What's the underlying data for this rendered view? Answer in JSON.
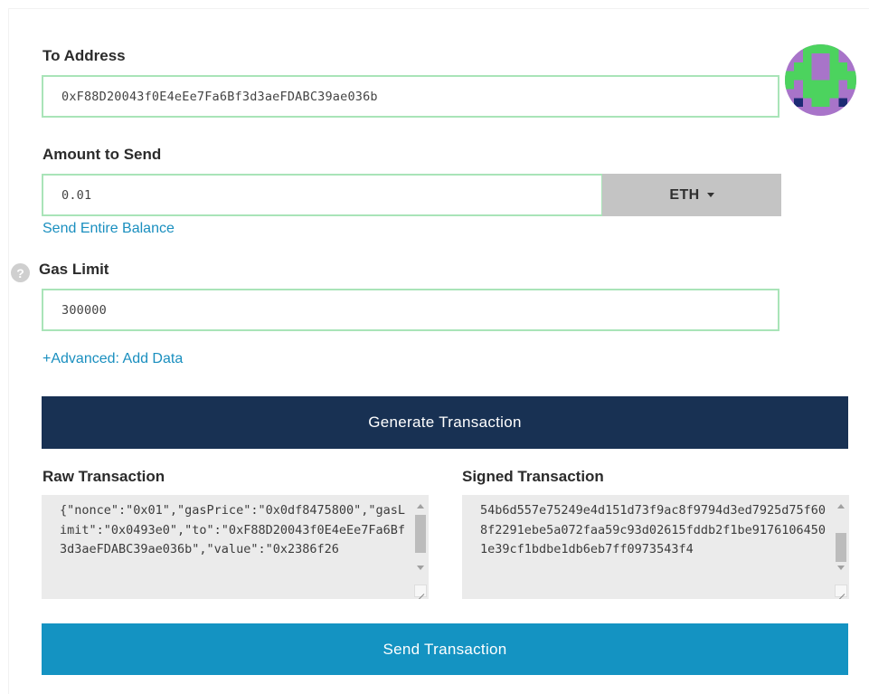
{
  "to_address": {
    "label": "To Address",
    "value": "0xF88D20043f0E4eEe7Fa6Bf3d3aeFDABC39ae036b"
  },
  "amount": {
    "label": "Amount to Send",
    "value": "0.01",
    "unit": "ETH",
    "send_entire_balance": "Send Entire Balance"
  },
  "gas_limit": {
    "label": "Gas Limit",
    "value": "300000",
    "help_icon": "?"
  },
  "advanced_link": "+Advanced: Add Data",
  "generate_button": "Generate Transaction",
  "raw_transaction": {
    "label": "Raw Transaction",
    "value": "{\"nonce\":\"0x01\",\"gasPrice\":\"0x0df8475800\",\"gasLimit\":\"0x0493e0\",\"to\":\"0xF88D20043f0E4eEe7Fa6Bf3d3aeFDABC39ae036b\",\"value\":\"0x2386f26"
  },
  "signed_transaction": {
    "label": "Signed Transaction",
    "value": "54b6d557e75249e4d151d73f9ac8f9794d3ed7925d75f608f2291ebe5a072faa59c93d02615fddb2f1be91761064501e39cf1bdbe1db6eb7ff0973543f4"
  },
  "send_button": "Send Transaction",
  "colors": {
    "field_border": "#a9e4b8",
    "navy": "#183153",
    "send_blue": "#1493c2",
    "link": "#1a8fbf"
  },
  "icons": {
    "identicon": "identicon",
    "help": "question-circle-icon",
    "dropdown": "caret-down-icon"
  }
}
